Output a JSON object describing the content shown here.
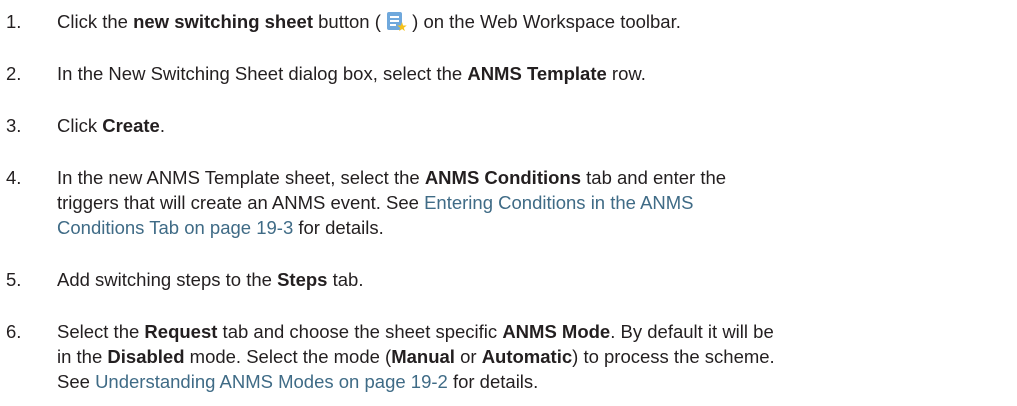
{
  "steps": [
    {
      "number": "1.",
      "parts": {
        "a": "Click the ",
        "b_bold": "new switching sheet",
        "c": " button ( ",
        "icon": "new-switching-sheet-icon",
        "d": " ) on the Web Workspace toolbar."
      }
    },
    {
      "number": "2.",
      "parts": {
        "a": "In the New Switching Sheet dialog box, select the ",
        "b_bold": "ANMS Template",
        "c": " row."
      }
    },
    {
      "number": "3.",
      "parts": {
        "a": "Click ",
        "b_bold": "Create",
        "c": "."
      }
    },
    {
      "number": "4.",
      "line1": {
        "a": "In the new ANMS Template sheet, select the ",
        "b_bold": "ANMS Conditions",
        "c": " tab and enter the"
      },
      "line2": {
        "a": "triggers that will create an ANMS event. See ",
        "link": "Entering Conditions in the ANMS"
      },
      "line3": {
        "link": "Conditions Tab on page 19-3",
        "a": " for details."
      }
    },
    {
      "number": "5.",
      "parts": {
        "a": "Add switching steps to the ",
        "b_bold": "Steps",
        "c": " tab."
      }
    },
    {
      "number": "6.",
      "line1": {
        "a": "Select the ",
        "b_bold": "Request",
        "c": " tab and choose the sheet specific ",
        "d_bold": "ANMS Mode",
        "e": ". By default it will be"
      },
      "line2": {
        "a": "in the ",
        "b_bold": "Disabled",
        "c": " mode. Select the mode (",
        "d_bold": "Manual",
        "e": " or ",
        "f_bold": "Automatic",
        "g": ") to process the scheme."
      },
      "line3": {
        "a": "See ",
        "link": "Understanding ANMS Modes on page 19-2",
        "b": " for details."
      }
    }
  ]
}
